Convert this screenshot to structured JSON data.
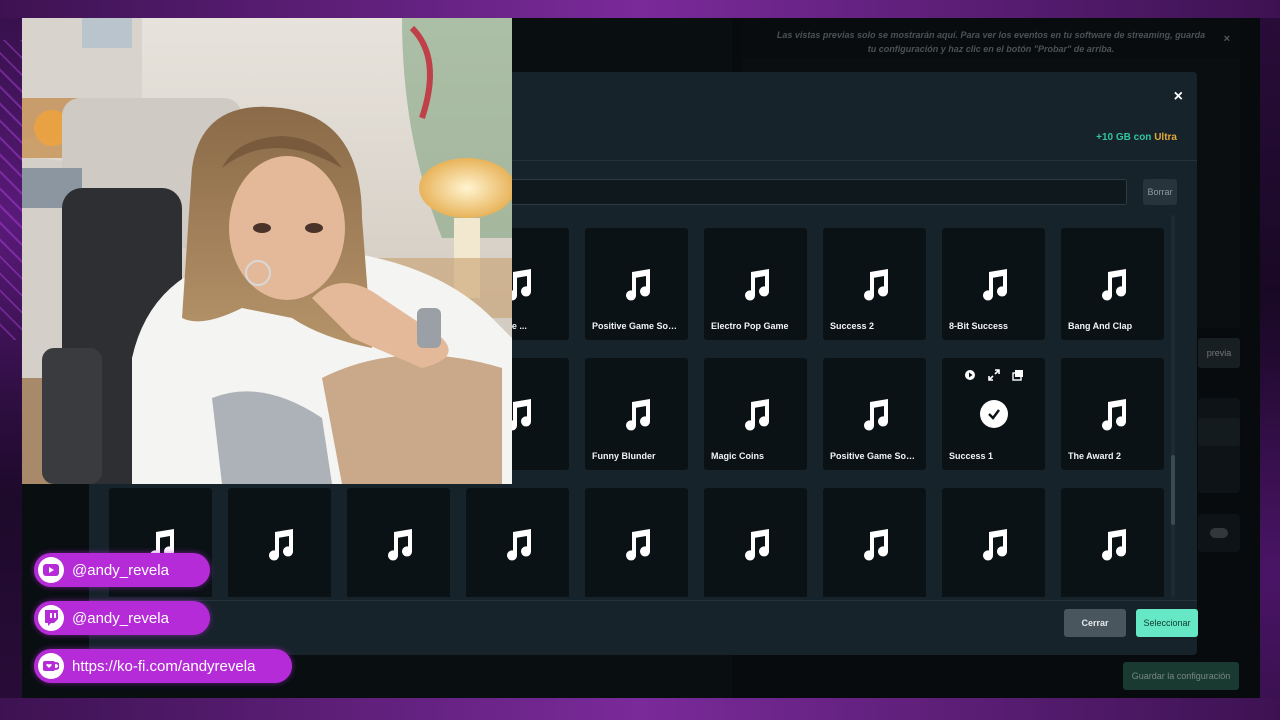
{
  "notice": {
    "text": "Las vistas previas solo se mostrarán aquí. Para ver los eventos en tu software de streaming, guarda tu configuración y haz clic en el botón \"Probar\" de arriba.",
    "close": "×"
  },
  "background": {
    "preview_button": "previa",
    "save_button": "Guardar la configuración"
  },
  "modal": {
    "close": "×",
    "ultra_plus": "+10 GB con",
    "ultra_label": "Ultra",
    "search_value": "",
    "clear_button": "Borrar",
    "cancel_button": "Cerrar",
    "select_button": "Seleccionar"
  },
  "sounds": {
    "row0": [
      "",
      "",
      "",
      "",
      "",
      "",
      "",
      "",
      ""
    ],
    "row1": [
      "",
      "",
      "",
      "Win Game ...",
      "Positive Game Soun...",
      "Electro Pop Game",
      "Success 2",
      "8-Bit Success",
      "Bang And Clap"
    ],
    "row2": [
      "",
      "",
      "",
      "s",
      "Funny Blunder",
      "Magic Coins",
      "Positive Game Soun...",
      "Success 1",
      "The Award 2"
    ],
    "row3": [
      "",
      "",
      "",
      "",
      "",
      "",
      "",
      "",
      ""
    ],
    "selected_index": 7
  },
  "socials": [
    {
      "handle": "@andy_revela",
      "icon": "youtube-icon"
    },
    {
      "handle": "@andy_revela",
      "icon": "twitch-icon"
    },
    {
      "handle": "https://ko-fi.com/andyrevela",
      "icon": "kofi-icon"
    }
  ],
  "colors": {
    "accent": "#31c3a2",
    "select_button": "#66e8c6",
    "ultra": "#e0a83a",
    "social_pill": "#b62bd8"
  }
}
